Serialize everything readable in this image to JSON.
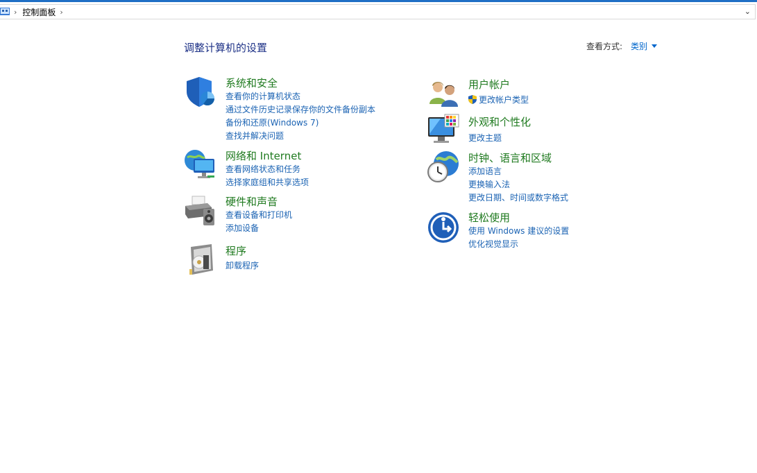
{
  "address_bar": {
    "breadcrumb": "控制面板",
    "sep": "›",
    "dropdown": "⌄"
  },
  "header": {
    "title": "调整计算机的设置",
    "view_by_label": "查看方式:",
    "view_by_value": "类别"
  },
  "categories": {
    "system_security": {
      "title": "系统和安全",
      "links": [
        "查看你的计算机状态",
        "通过文件历史记录保存你的文件备份副本",
        "备份和还原(Windows 7)",
        "查找并解决问题"
      ]
    },
    "network": {
      "title": "网络和 Internet",
      "links": [
        "查看网络状态和任务",
        "选择家庭组和共享选项"
      ]
    },
    "hardware": {
      "title": "硬件和声音",
      "links": [
        "查看设备和打印机",
        "添加设备"
      ]
    },
    "programs": {
      "title": "程序",
      "links": [
        "卸载程序"
      ]
    },
    "user_accounts": {
      "title": "用户帐户",
      "links": [
        "更改帐户类型"
      ]
    },
    "appearance": {
      "title": "外观和个性化",
      "links": [
        "更改主题"
      ]
    },
    "clock_region": {
      "title": "时钟、语言和区域",
      "links": [
        "添加语言",
        "更换输入法",
        "更改日期、时间或数字格式"
      ]
    },
    "ease_access": {
      "title": "轻松使用",
      "links": [
        "使用 Windows 建议的设置",
        "优化视觉显示"
      ]
    }
  },
  "colors": {
    "title_blue": "#1e3287",
    "category_green": "#1f7a1f",
    "link_blue": "#1b63b3"
  },
  "icons": [
    "control-panel-icon",
    "shield-icon",
    "network-icon",
    "printer-icon",
    "programs-icon",
    "users-icon",
    "monitor-palette-icon",
    "clock-globe-icon",
    "ease-of-access-icon",
    "uac-shield-icon"
  ]
}
